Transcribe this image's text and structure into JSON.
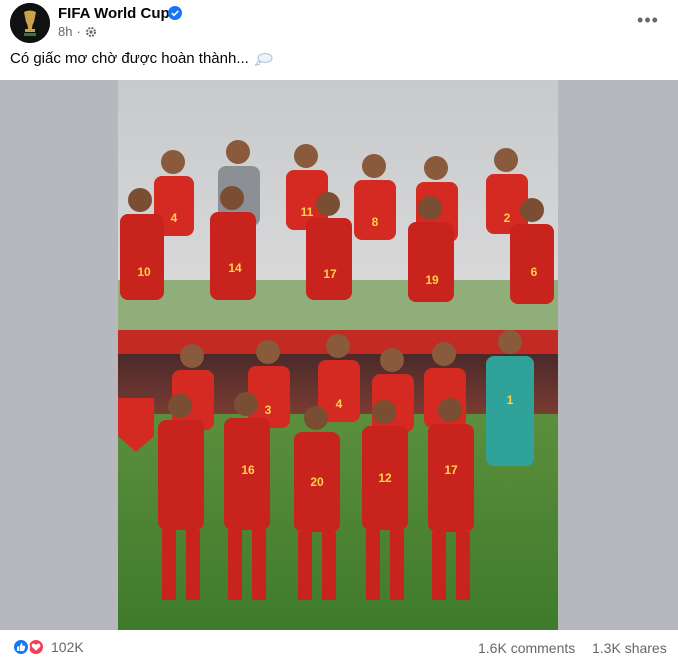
{
  "post": {
    "page_name": "FIFA World Cup",
    "time": "8h",
    "caption": "Có giấc mơ chờ được hoàn thành...",
    "top_photo_numbers": [
      "4",
      "11",
      "8",
      "2",
      "10",
      "14",
      "17",
      "19",
      "6"
    ],
    "bottom_photo_numbers": [
      "3",
      "4",
      "1",
      "16",
      "20",
      "12",
      "17"
    ]
  },
  "footer": {
    "reaction_count": "102K",
    "comments": "1.6K comments",
    "shares": "1.3K shares"
  },
  "colors": {
    "facebook_blue": "#1877f2",
    "love_red": "#f33e58",
    "jersey_red": "#d42a22",
    "keeper_green": "#2fa39a"
  }
}
